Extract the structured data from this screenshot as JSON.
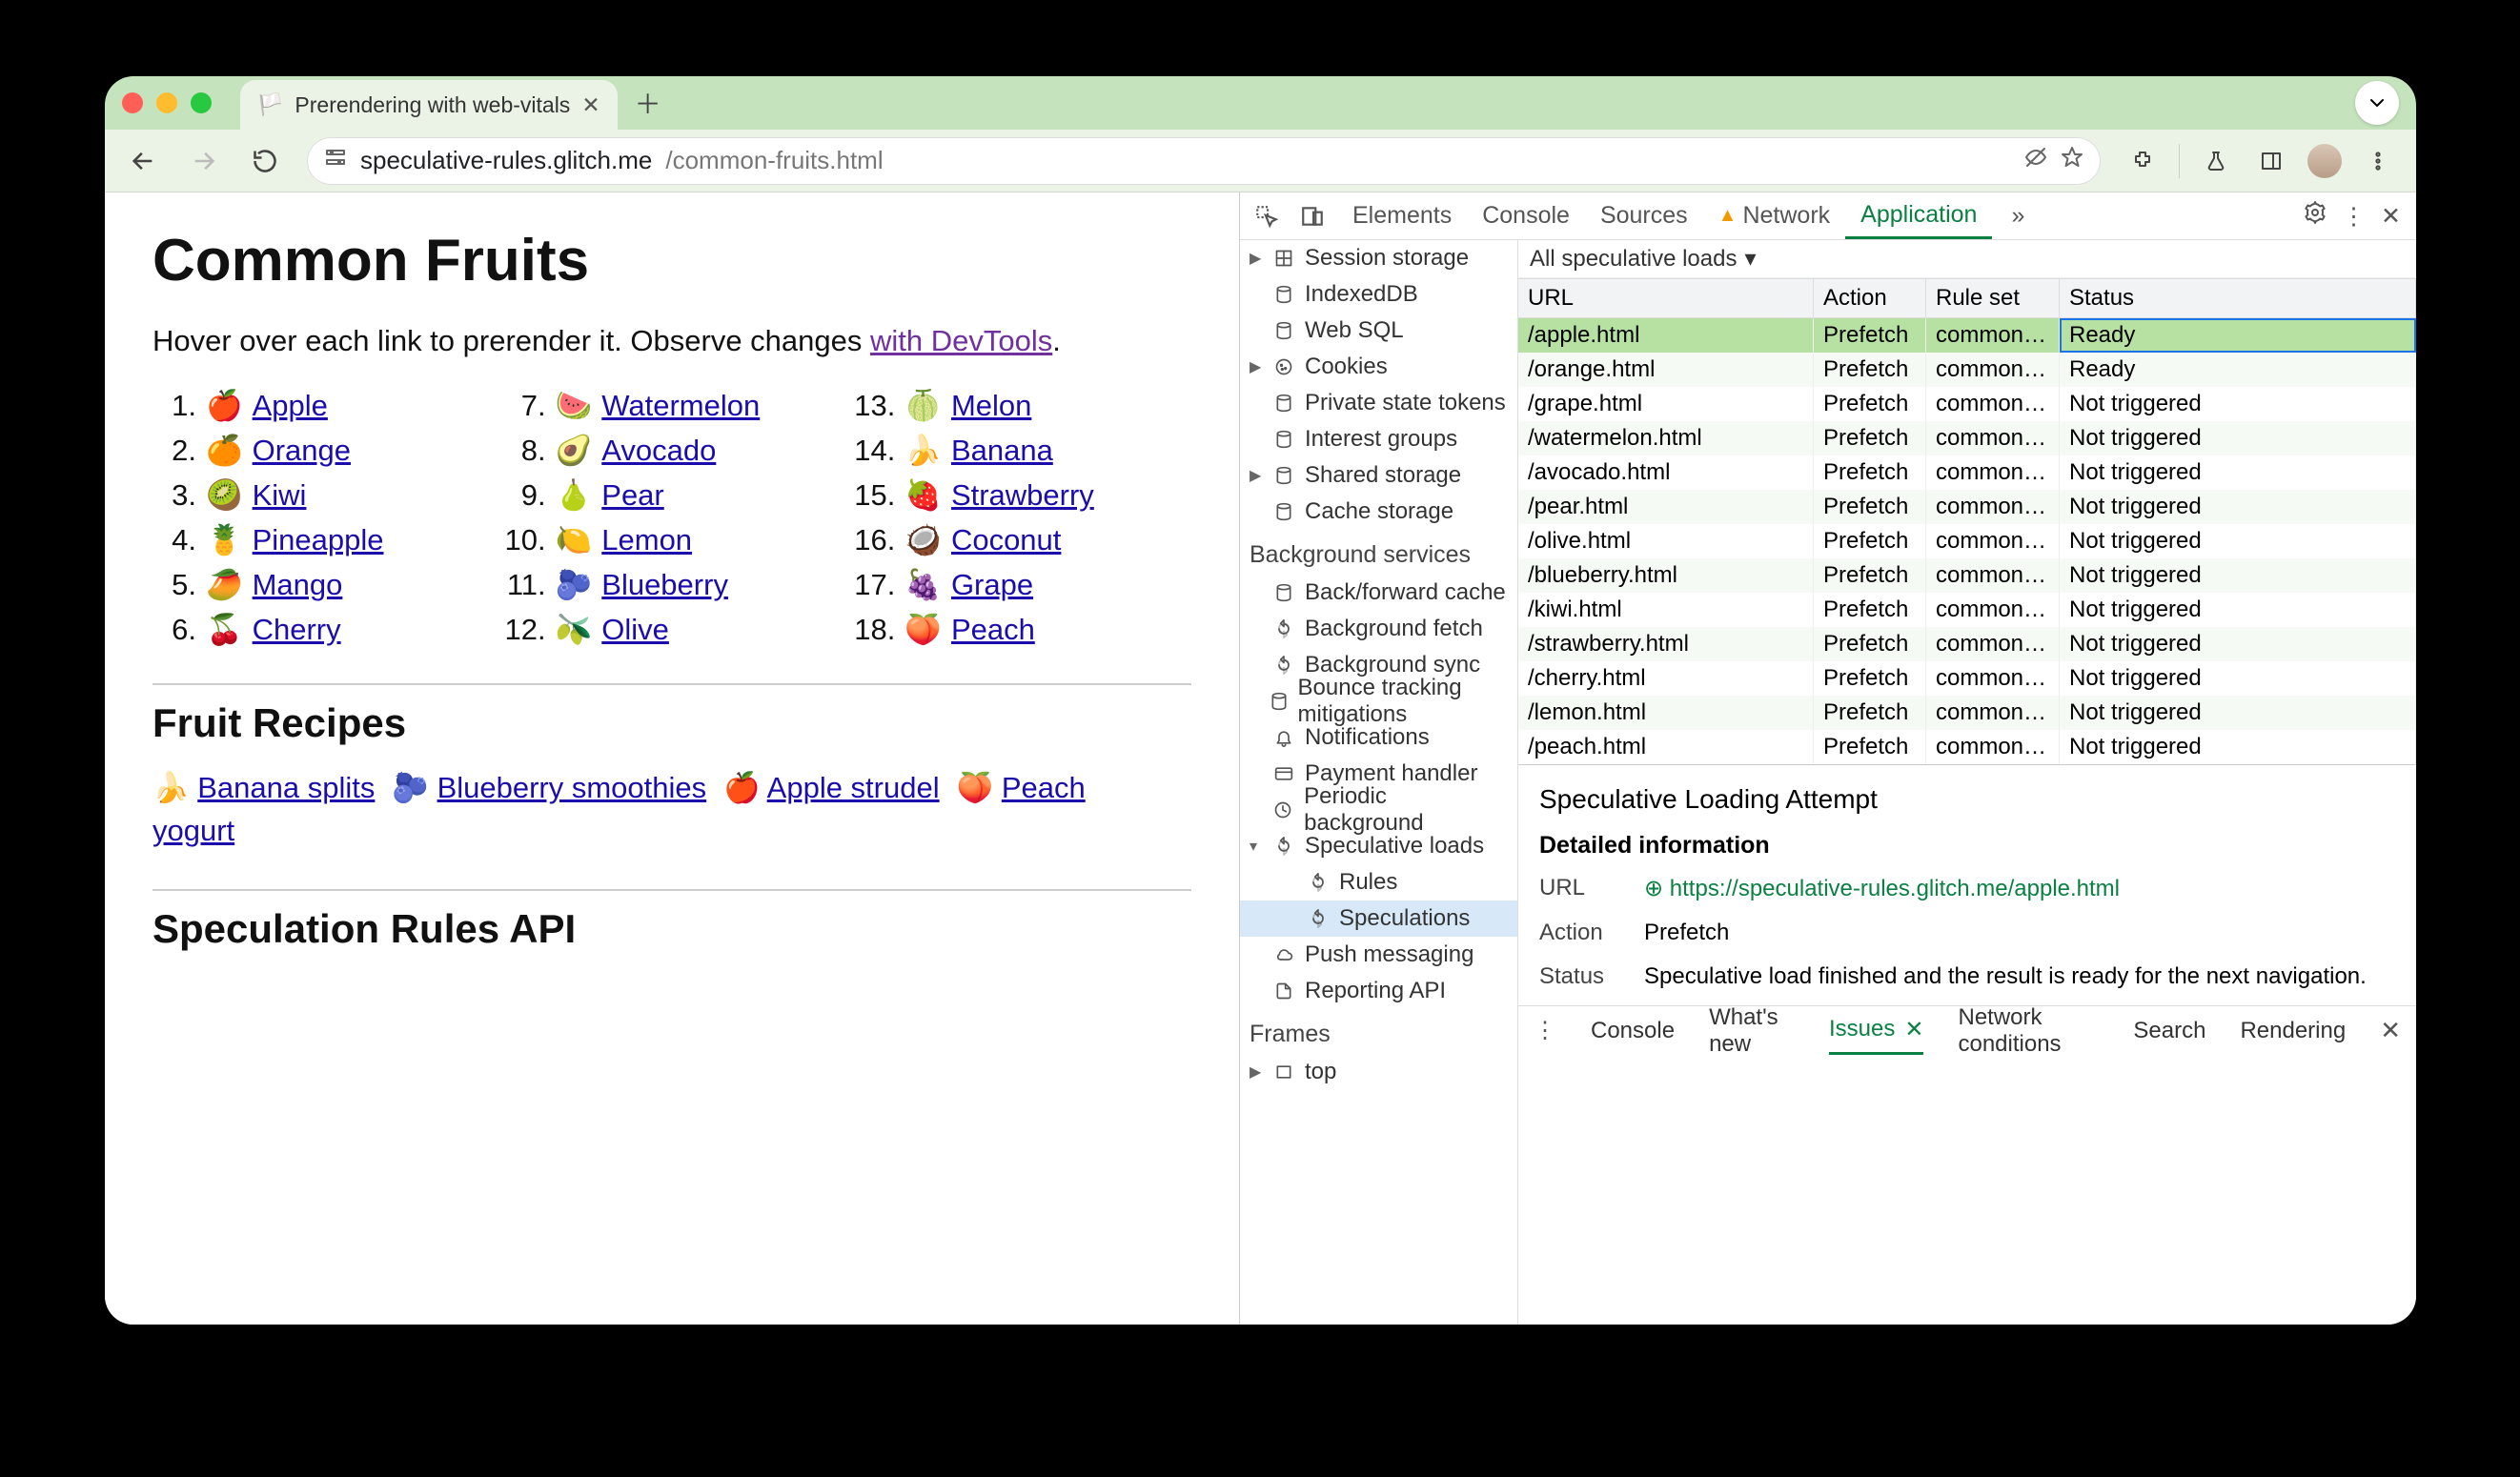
{
  "window": {
    "tab_title": "Prerendering with web-vitals",
    "tab_favicon": "🏳️"
  },
  "toolbar": {
    "url_host": "speculative-rules.glitch.me",
    "url_path": "/common-fruits.html"
  },
  "page": {
    "h1": "Common Fruits",
    "lead_a": "Hover over each link to prerender it. Observe changes ",
    "lead_link": "with DevTools",
    "lead_b": ".",
    "fruits": [
      {
        "n": "1.",
        "e": "🍎",
        "t": "Apple"
      },
      {
        "n": "2.",
        "e": "🍊",
        "t": "Orange"
      },
      {
        "n": "3.",
        "e": "🥝",
        "t": "Kiwi"
      },
      {
        "n": "4.",
        "e": "🍍",
        "t": "Pineapple"
      },
      {
        "n": "5.",
        "e": "🥭",
        "t": "Mango"
      },
      {
        "n": "6.",
        "e": "🍒",
        "t": "Cherry"
      },
      {
        "n": "7.",
        "e": "🍉",
        "t": "Watermelon"
      },
      {
        "n": "8.",
        "e": "🥑",
        "t": "Avocado"
      },
      {
        "n": "9.",
        "e": "🍐",
        "t": "Pear"
      },
      {
        "n": "10.",
        "e": "🍋",
        "t": "Lemon"
      },
      {
        "n": "11.",
        "e": "🫐",
        "t": "Blueberry"
      },
      {
        "n": "12.",
        "e": "🫒",
        "t": "Olive"
      },
      {
        "n": "13.",
        "e": "🍈",
        "t": "Melon"
      },
      {
        "n": "14.",
        "e": "🍌",
        "t": "Banana"
      },
      {
        "n": "15.",
        "e": "🍓",
        "t": "Strawberry"
      },
      {
        "n": "16.",
        "e": "🥥",
        "t": "Coconut"
      },
      {
        "n": "17.",
        "e": "🍇",
        "t": "Grape"
      },
      {
        "n": "18.",
        "e": "🍑",
        "t": "Peach"
      }
    ],
    "h2a": "Fruit Recipes",
    "recipes": [
      {
        "e": "🍌",
        "t": "Banana splits"
      },
      {
        "e": "🫐",
        "t": "Blueberry smoothies"
      },
      {
        "e": "🍎",
        "t": "Apple strudel"
      },
      {
        "e": "🍑",
        "t": "Peach yogurt"
      }
    ],
    "h2b": "Speculation Rules API"
  },
  "devtools": {
    "tabs": [
      "Elements",
      "Console",
      "Sources",
      "Network",
      "Application"
    ],
    "active_tab": "Application",
    "overflow": "»",
    "side_storage": [
      {
        "caret": "▶",
        "icon": "grid",
        "label": "Session storage"
      },
      {
        "caret": "",
        "icon": "db",
        "label": "IndexedDB"
      },
      {
        "caret": "",
        "icon": "db",
        "label": "Web SQL"
      },
      {
        "caret": "▶",
        "icon": "cookie",
        "label": "Cookies"
      },
      {
        "caret": "",
        "icon": "db",
        "label": "Private state tokens"
      },
      {
        "caret": "",
        "icon": "db",
        "label": "Interest groups"
      },
      {
        "caret": "▶",
        "icon": "db",
        "label": "Shared storage"
      },
      {
        "caret": "",
        "icon": "db",
        "label": "Cache storage"
      }
    ],
    "side_bg_title": "Background services",
    "side_bg": [
      {
        "icon": "db",
        "label": "Back/forward cache"
      },
      {
        "icon": "sync",
        "label": "Background fetch"
      },
      {
        "icon": "sync",
        "label": "Background sync"
      },
      {
        "icon": "db",
        "label": "Bounce tracking mitigations"
      },
      {
        "icon": "bell",
        "label": "Notifications"
      },
      {
        "icon": "card",
        "label": "Payment handler"
      },
      {
        "icon": "clock",
        "label": "Periodic background"
      },
      {
        "icon": "sync",
        "label": "Speculative loads",
        "caret": "▾",
        "children": [
          {
            "icon": "sync",
            "label": "Rules"
          },
          {
            "icon": "sync",
            "label": "Speculations",
            "selected": true
          }
        ]
      },
      {
        "icon": "cloud",
        "label": "Push messaging"
      },
      {
        "icon": "doc",
        "label": "Reporting API"
      }
    ],
    "frames_title": "Frames",
    "frames": [
      {
        "caret": "▶",
        "icon": "frame",
        "label": "top"
      }
    ],
    "filter_label": "All speculative loads",
    "columns": [
      "URL",
      "Action",
      "Rule set",
      "Status"
    ],
    "rows": [
      {
        "url": "/apple.html",
        "action": "Prefetch",
        "rule": "common-…",
        "status": "Ready",
        "sel": true
      },
      {
        "url": "/orange.html",
        "action": "Prefetch",
        "rule": "common-…",
        "status": "Ready"
      },
      {
        "url": "/grape.html",
        "action": "Prefetch",
        "rule": "common-…",
        "status": "Not triggered"
      },
      {
        "url": "/watermelon.html",
        "action": "Prefetch",
        "rule": "common-…",
        "status": "Not triggered"
      },
      {
        "url": "/avocado.html",
        "action": "Prefetch",
        "rule": "common-…",
        "status": "Not triggered"
      },
      {
        "url": "/pear.html",
        "action": "Prefetch",
        "rule": "common-…",
        "status": "Not triggered"
      },
      {
        "url": "/olive.html",
        "action": "Prefetch",
        "rule": "common-…",
        "status": "Not triggered"
      },
      {
        "url": "/blueberry.html",
        "action": "Prefetch",
        "rule": "common-…",
        "status": "Not triggered"
      },
      {
        "url": "/kiwi.html",
        "action": "Prefetch",
        "rule": "common-…",
        "status": "Not triggered"
      },
      {
        "url": "/strawberry.html",
        "action": "Prefetch",
        "rule": "common-…",
        "status": "Not triggered"
      },
      {
        "url": "/cherry.html",
        "action": "Prefetch",
        "rule": "common-…",
        "status": "Not triggered"
      },
      {
        "url": "/lemon.html",
        "action": "Prefetch",
        "rule": "common-…",
        "status": "Not triggered"
      },
      {
        "url": "/peach.html",
        "action": "Prefetch",
        "rule": "common-…",
        "status": "Not triggered"
      }
    ],
    "detail": {
      "title": "Speculative Loading Attempt",
      "subtitle": "Detailed information",
      "kv": [
        {
          "k": "URL",
          "v": "https://speculative-rules.glitch.me/apple.html",
          "link": true
        },
        {
          "k": "Action",
          "v": "Prefetch"
        },
        {
          "k": "Status",
          "v": "Speculative load finished and the result is ready for the next navigation."
        }
      ]
    },
    "drawer": [
      "Console",
      "What's new",
      "Issues",
      "Network conditions",
      "Search",
      "Rendering"
    ],
    "drawer_active": "Issues"
  }
}
